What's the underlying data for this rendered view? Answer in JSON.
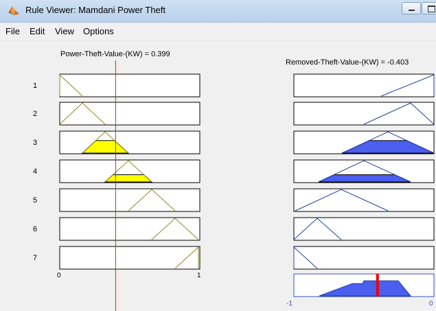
{
  "window": {
    "title": "Rule Viewer: Mamdani Power Theft"
  },
  "menu": [
    {
      "label": "File"
    },
    {
      "label": "Edit"
    },
    {
      "label": "View"
    },
    {
      "label": "Options"
    }
  ],
  "input": {
    "header": "Power-Theft-Value-(KW) = 0.399",
    "value": 0.399,
    "range": [
      0,
      1
    ],
    "tick_min": "0",
    "tick_max": "1"
  },
  "output": {
    "header": "Removed-Theft-Value-(KW) = -0.403",
    "value": -0.403,
    "range": [
      -1,
      0
    ],
    "tick_min": "-1",
    "tick_max": "0"
  },
  "rules": [
    {
      "number": "1"
    },
    {
      "number": "2"
    },
    {
      "number": "3"
    },
    {
      "number": "4"
    },
    {
      "number": "5"
    },
    {
      "number": "6"
    },
    {
      "number": "7"
    }
  ],
  "colors": {
    "input_mf": "#8a8a1e",
    "input_fill": "#ffff00",
    "output_mf": "#1f3f9f",
    "output_fill": "#4a5ff0",
    "cursor": "#cc2a2a",
    "output_cursor": "#ee0000"
  }
}
